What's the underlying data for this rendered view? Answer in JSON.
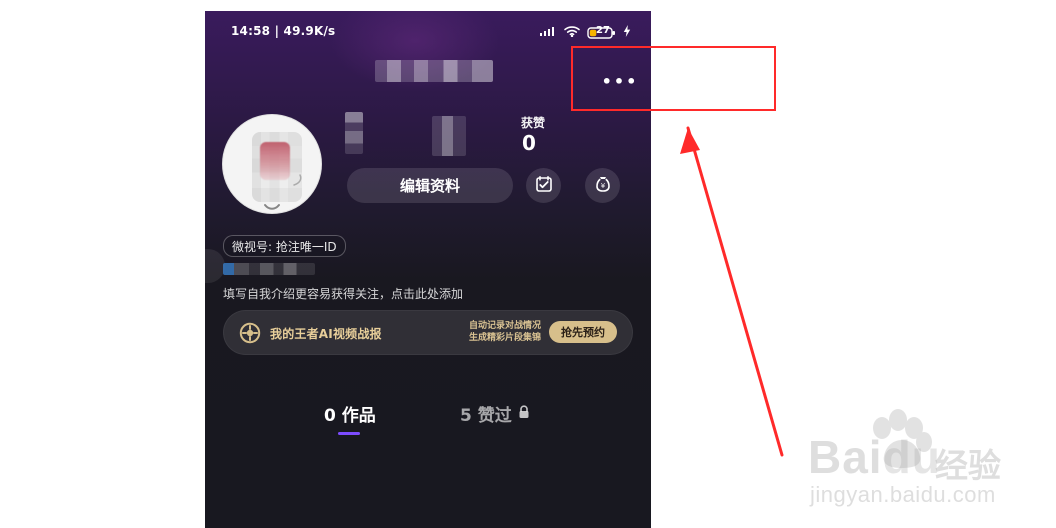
{
  "status_bar": {
    "time_speed": "14:58 | 49.9K/s",
    "battery_text": "27"
  },
  "profile": {
    "likes_label": "获赞",
    "likes_count": "0",
    "edit_profile_label": "编辑资料",
    "id_chip_text": "微视号: 抢注唯一ID",
    "bio_placeholder": "填写自我介绍更容易获得关注，点击此处添加"
  },
  "ai_banner": {
    "title": "我的王者AI视频战报",
    "desc_line1": "自动记录对战情况",
    "desc_line2": "生成精彩片段集锦",
    "cta": "抢先预约"
  },
  "tabs": [
    {
      "label": "0 作品",
      "active": true
    },
    {
      "label": "5 赞过",
      "active": false
    }
  ],
  "top_bar": {
    "more_label": "•••"
  },
  "watermark": {
    "brand": "Bai",
    "brand_suffix": "du",
    "jingyan": "经验",
    "url": "jingyan.baidu.com"
  },
  "colors": {
    "accent_purple": "#7d4cff",
    "gold": "#d7bf8b",
    "gold_text": "#e8cf9a",
    "red_annotation": "#ff2a2a"
  }
}
